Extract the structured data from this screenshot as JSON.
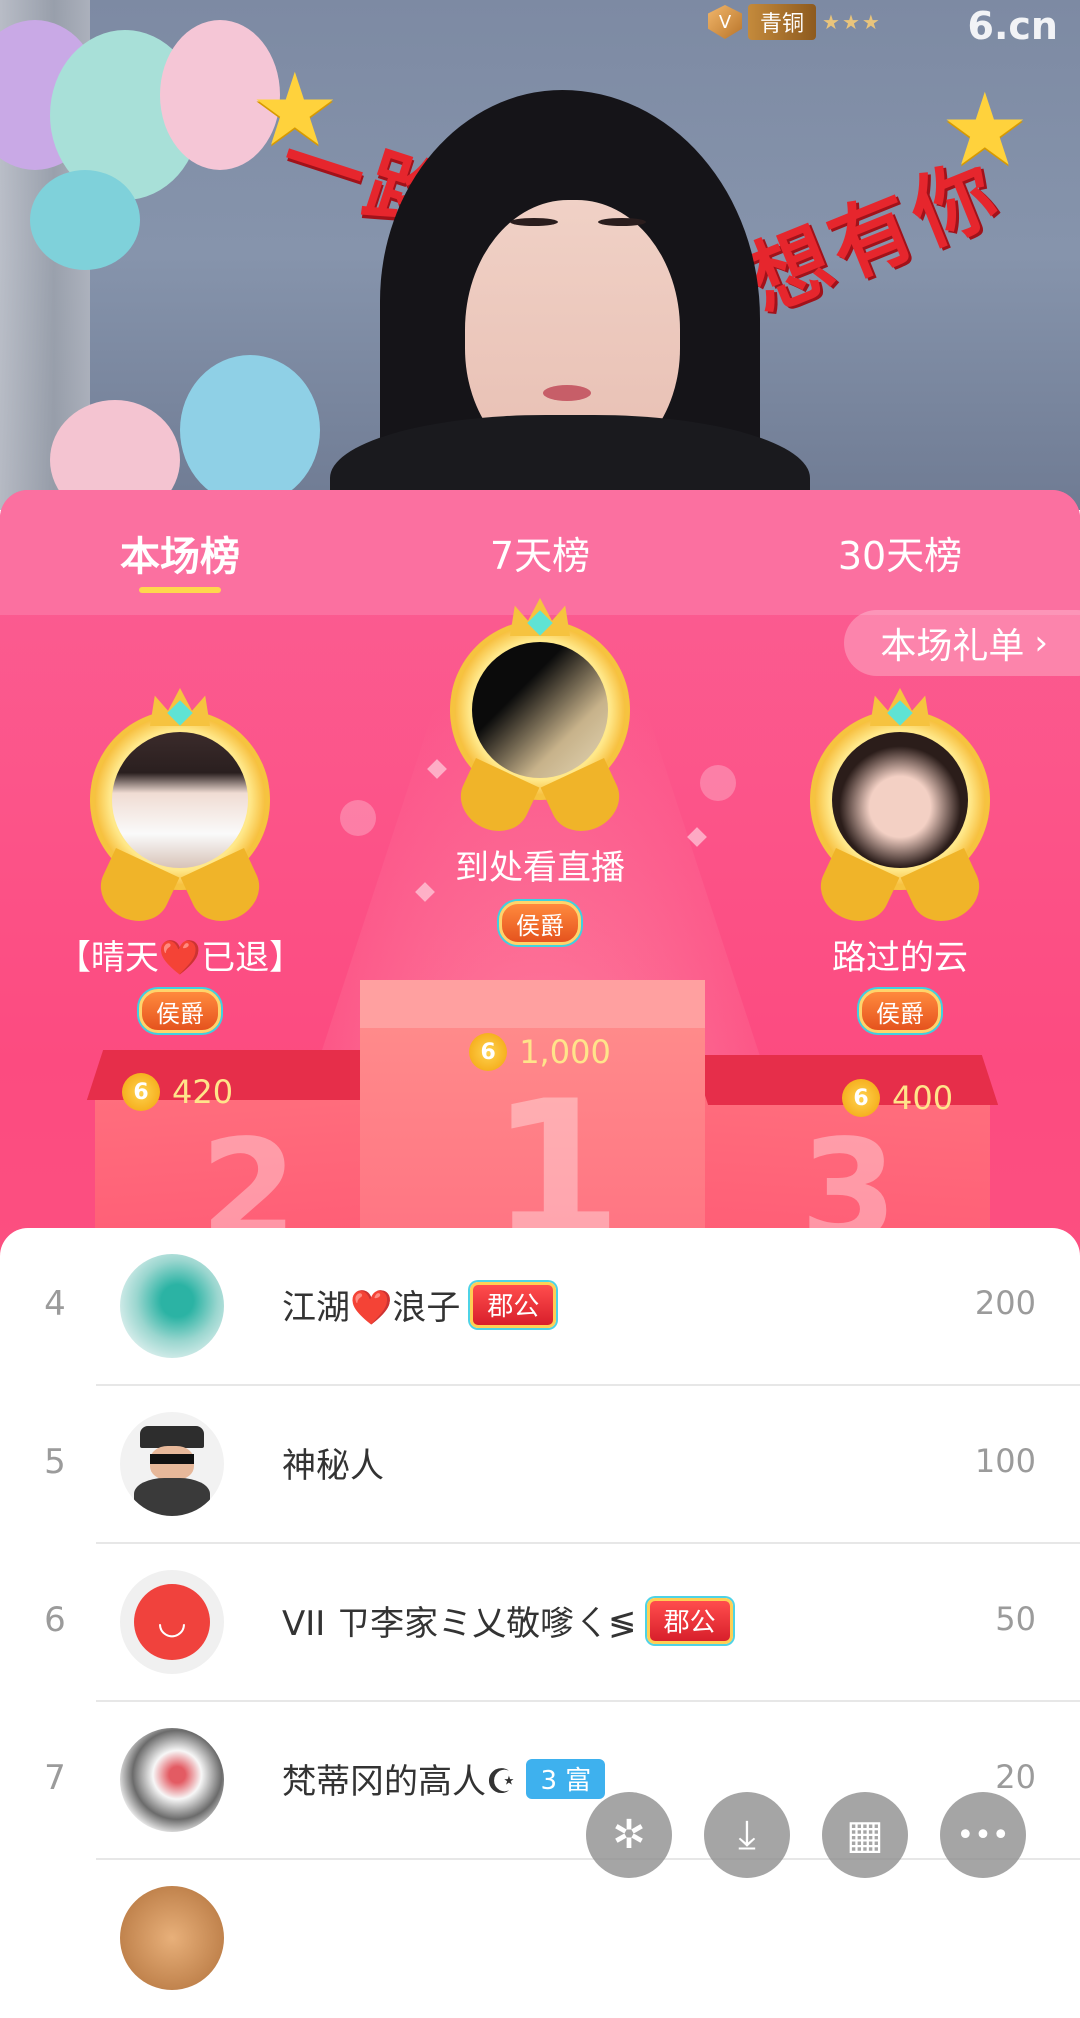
{
  "stream": {
    "rank_badge_label": "青铜",
    "rank_stars": "★★★",
    "rank_icon": "bronze-shield-icon",
    "logo_text": "6.cn",
    "banner_left": "一路陪",
    "banner_right": "想有你"
  },
  "tabs": [
    {
      "label": "本场榜",
      "active": true
    },
    {
      "label": "7天榜",
      "active": false
    },
    {
      "label": "30天榜",
      "active": false
    }
  ],
  "gift_list_button": {
    "label": "本场礼单",
    "chevron": "›"
  },
  "podium": {
    "first": {
      "name": "到处看直播",
      "tag": "侯爵",
      "value": "1,000",
      "place": "1"
    },
    "second": {
      "name": "【晴天❤️已退】",
      "tag": "侯爵",
      "value": "420",
      "place": "2"
    },
    "third": {
      "name": "路过的云",
      "tag": "侯爵",
      "value": "400",
      "place": "3"
    }
  },
  "coin_symbol": "6",
  "list": [
    {
      "rank": "4",
      "name": "江湖❤️浪子",
      "tag": "郡公",
      "tag_type": "jun",
      "score": "200",
      "avatar": "dragon-avatar"
    },
    {
      "rank": "5",
      "name": "神秘人",
      "tag": "",
      "tag_type": "",
      "score": "100",
      "avatar": "mystery-man-avatar"
    },
    {
      "rank": "6",
      "name": "VII ㄗ李家ミ乂敬嗲ㄑ≶",
      "tag": "郡公",
      "tag_type": "jun",
      "score": "50",
      "avatar": "red-smiley-avatar"
    },
    {
      "rank": "7",
      "name": "梵蒂冈的高人☪",
      "tag": "3 富",
      "tag_type": "fu",
      "score": "20",
      "avatar": "ink-fish-avatar"
    }
  ],
  "fabs": [
    {
      "name": "share-button",
      "icon": "share-icon",
      "glyph": "✲"
    },
    {
      "name": "download-button",
      "icon": "download-icon",
      "glyph": "⤓"
    },
    {
      "name": "apps-button",
      "icon": "grid-icon",
      "glyph": "▦"
    },
    {
      "name": "more-button",
      "icon": "more-icon",
      "glyph": "•••"
    }
  ],
  "colors": {
    "panel_pink": "#fc4b80",
    "tab_bar": "#fb70a0",
    "tab_underline": "#ffd64d",
    "coin_gold": "#f2a20c"
  }
}
